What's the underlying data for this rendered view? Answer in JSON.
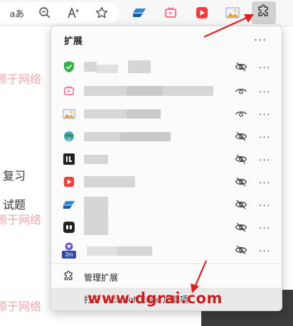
{
  "toolbar": {
    "icons": [
      "read-aloud-icon",
      "zoom-out-icon",
      "text-size-icon",
      "favorite-star-icon",
      "ext-blue-wedge-icon",
      "ext-tv-icon",
      "ext-play-icon",
      "ext-image-icon",
      "extensions-puzzle-icon"
    ],
    "read_aloud_glyph": "aあ",
    "colors": {
      "active_button_bg": "#d2d2d2",
      "toolbar_bg": "#f7f7f7"
    }
  },
  "page": {
    "text_1": "复习",
    "text_2": "试题",
    "watermark_1": "源于网络",
    "watermark_2": "源于网络",
    "watermark_3": "源于网络",
    "site_watermark": "www.dgrai.com"
  },
  "popup": {
    "title": "扩展",
    "more": "···",
    "extensions": [
      {
        "icon": "green-shield-icon",
        "name_fragment": "",
        "visibility": "hidden",
        "icon_color": "#2fb34a"
      },
      {
        "icon": "pink-tv-icon",
        "name_fragment": "",
        "visibility": "shown",
        "icon_color": "#ff5d7a"
      },
      {
        "icon": "picture-icon",
        "name_fragment": "",
        "visibility": "shown",
        "icon_color": "#6c87c6"
      },
      {
        "icon": "globe-download-icon",
        "name_fragment": "",
        "visibility": "hidden",
        "icon_color": "#27a243"
      },
      {
        "icon": "black-square-icon",
        "name_fragment": "",
        "visibility": "hidden",
        "icon_color": "#222222"
      },
      {
        "icon": "red-play-icon",
        "name_fragment": "",
        "visibility": "hidden",
        "icon_color": "#f23b3b"
      },
      {
        "icon": "blue-wedge-icon",
        "name_fragment": "",
        "visibility": "hidden",
        "icon_color": "#1f78d1"
      },
      {
        "icon": "black-rounded-icon",
        "name_fragment": "",
        "visibility": "hidden",
        "icon_color": "#222222"
      },
      {
        "icon": "2m-badge-icon",
        "name_fragment": "",
        "visibility": "hidden",
        "icon_color": "#2f49a8",
        "badge_text": "2m"
      }
    ],
    "manage_label": "管理扩展",
    "open_addons_label": "打开 Microsoft Edge 加载项"
  }
}
